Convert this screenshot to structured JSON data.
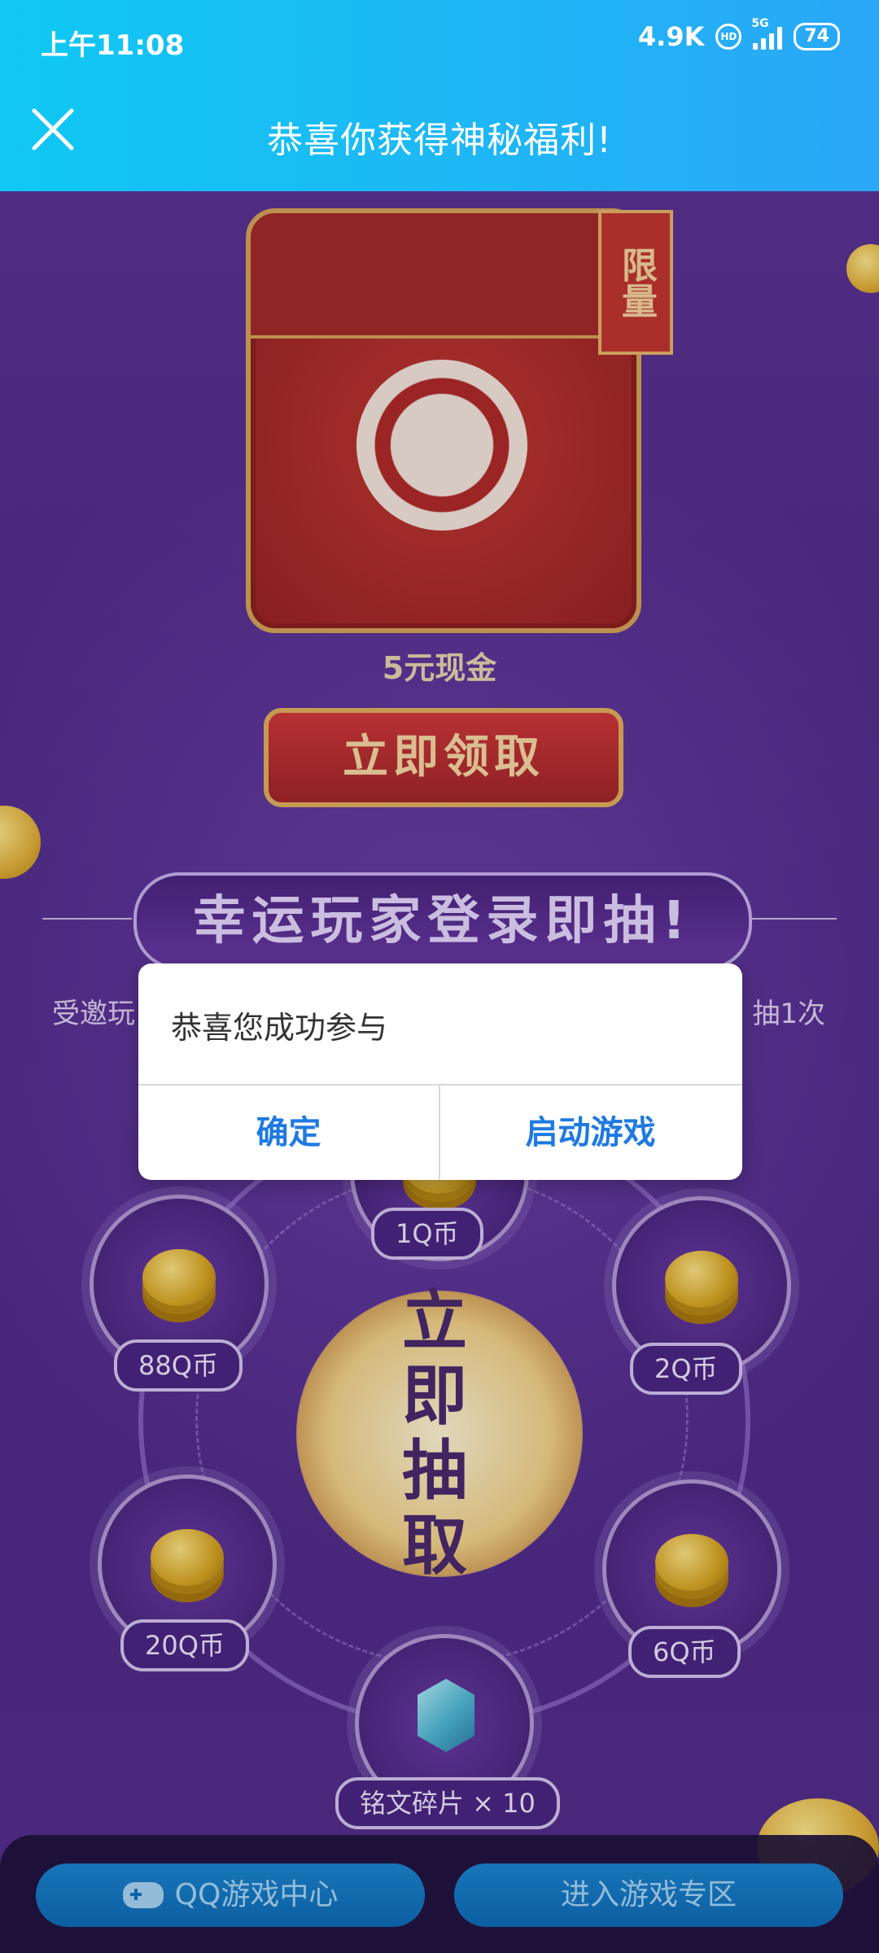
{
  "status_bar": {
    "time": "上午11:08",
    "network_speed": "4.9K",
    "hd": "HD",
    "network_type": "5G",
    "battery": "74"
  },
  "header": {
    "title": "恭喜你获得神秘福利!"
  },
  "red_packet": {
    "limit_tag": "限量",
    "cash_label": "5元现金",
    "claim_button": "立即领取"
  },
  "lucky_draw": {
    "banner": "幸运玩家登录即抽!",
    "invite_text_left": "受邀玩",
    "invite_text_right": "抽1次",
    "center_button": "立即抽取",
    "prizes": [
      "1Q币",
      "88Q币",
      "2Q币",
      "20Q币",
      "6Q币",
      "铭文碎片 × 10"
    ]
  },
  "bottom_bar": {
    "left_button": "QQ游戏中心",
    "right_button": "进入游戏专区"
  },
  "dialog": {
    "message": "恭喜您成功参与",
    "confirm": "确定",
    "launch": "启动游戏"
  },
  "colors": {
    "header_gradient_start": "#10c8f3",
    "background_purple": "#5a2f92",
    "dialog_button_text": "#1f7ae0"
  }
}
